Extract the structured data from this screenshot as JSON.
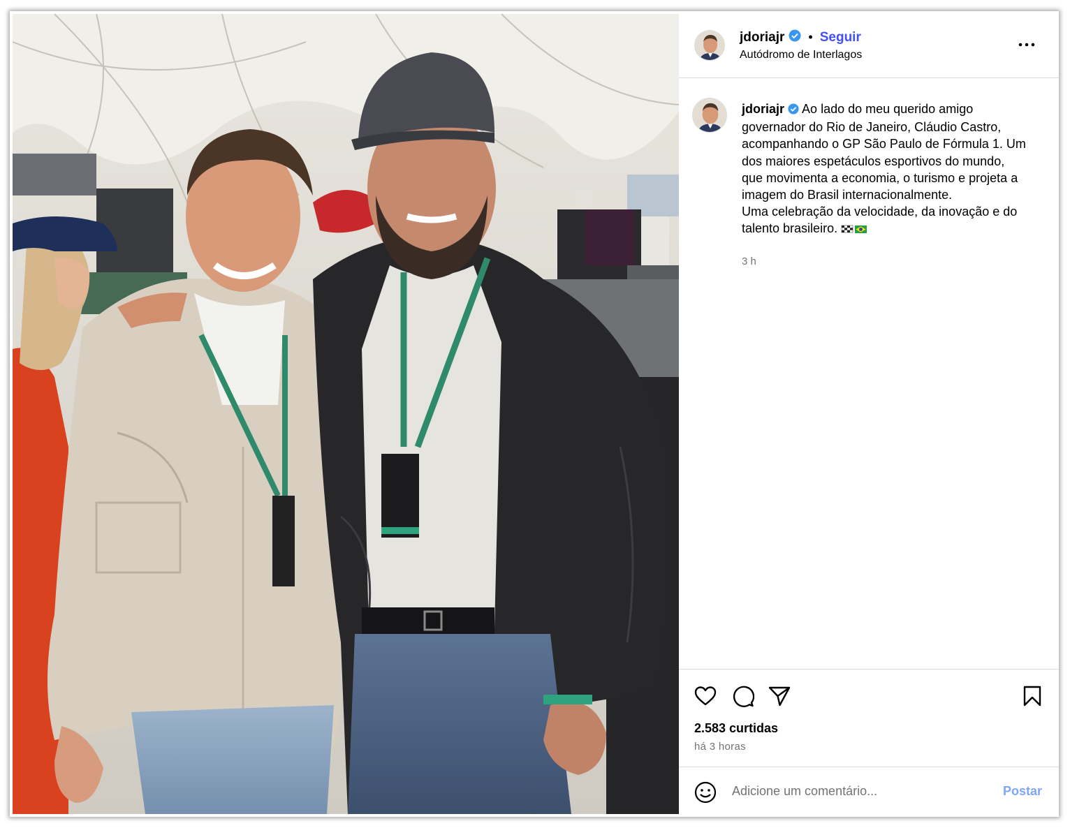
{
  "post": {
    "username": "jdoriajr",
    "verified": true,
    "follow_label": "Seguir",
    "separator": "•",
    "location": "Autódromo de Interlagos",
    "more_icon": "more-options-icon",
    "caption_lines": [
      "Ao lado do meu querido amigo",
      "governador do Rio de Janeiro, Cláudio Castro,",
      "acompanhando o GP São Paulo de Fórmula 1. Um",
      "dos maiores espetáculos esportivos do mundo,",
      "que movimenta a economia, o turismo e projeta a",
      "imagem do Brasil internacionalmente.",
      "Uma celebração da velocidade, da inovação e do",
      "talento brasileiro."
    ],
    "caption_emoji": "🏁🇧🇷",
    "caption_time": "3 h",
    "likes": "2.583 curtidas",
    "posted_ago": "há 3 horas",
    "comment_placeholder": "Adicione um comentário...",
    "post_label": "Postar"
  },
  "colors": {
    "follow": "#4150f7",
    "verified": "#3897f0",
    "post_disabled": "#7fa6f7",
    "muted": "#737373",
    "divider": "#dbdbdb"
  },
  "icons": [
    "heart-icon",
    "comment-icon",
    "share-icon",
    "bookmark-icon",
    "emoji-icon",
    "verified-badge-icon"
  ]
}
